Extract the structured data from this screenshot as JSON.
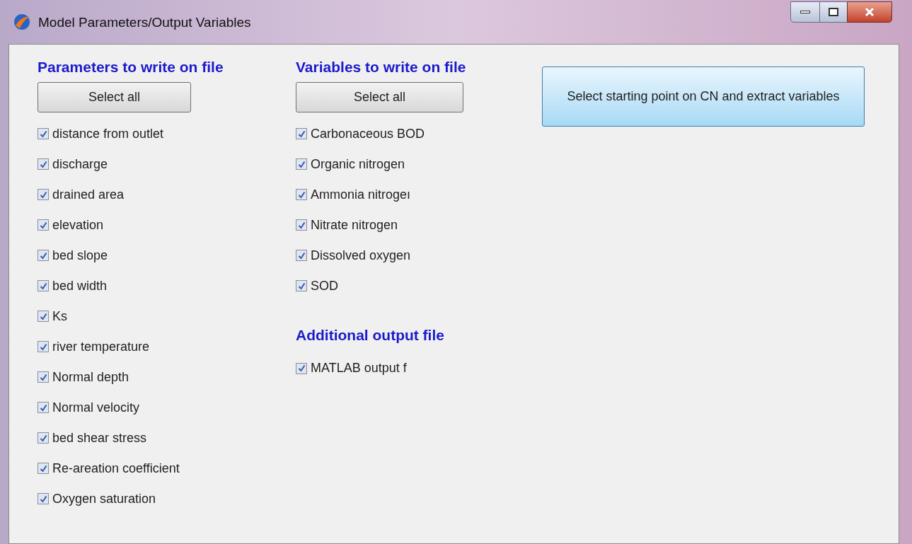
{
  "window": {
    "title": "Model Parameters/Output Variables"
  },
  "parameters": {
    "heading": "Parameters to write on file",
    "select_all": "Select all",
    "items": [
      {
        "label": "distance from outlet",
        "checked": true
      },
      {
        "label": "discharge",
        "checked": true
      },
      {
        "label": "drained area",
        "checked": true
      },
      {
        "label": "elevation",
        "checked": true
      },
      {
        "label": "bed slope",
        "checked": true
      },
      {
        "label": "bed width",
        "checked": true
      },
      {
        "label": "Ks",
        "checked": true
      },
      {
        "label": "river temperature",
        "checked": true
      },
      {
        "label": "Normal depth",
        "checked": true
      },
      {
        "label": "Normal velocity",
        "checked": true
      },
      {
        "label": "bed shear stress",
        "checked": true
      },
      {
        "label": "Re-areation coefficient",
        "checked": true
      },
      {
        "label": "Oxygen saturation",
        "checked": true
      }
    ]
  },
  "variables": {
    "heading": "Variables to write on file",
    "select_all": "Select all",
    "items": [
      {
        "label": "Carbonaceous BOD",
        "checked": true
      },
      {
        "label": "Organic nitrogen",
        "checked": true
      },
      {
        "label": "Ammonia nitrogeı",
        "checked": true
      },
      {
        "label": "Nitrate nitrogen",
        "checked": true
      },
      {
        "label": "Dissolved oxygen",
        "checked": true
      },
      {
        "label": "SOD",
        "checked": true
      }
    ]
  },
  "additional": {
    "heading": "Additional output file",
    "items": [
      {
        "label": "MATLAB output f",
        "checked": true
      }
    ]
  },
  "extract_button": "Select starting point on CN and extract variables"
}
